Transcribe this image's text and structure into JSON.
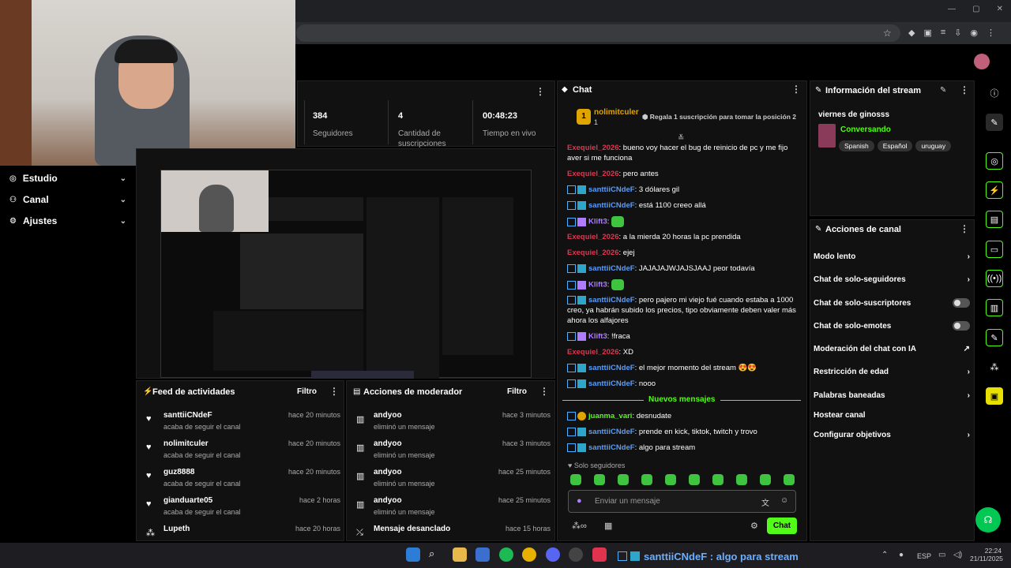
{
  "browser": {
    "window_controls": [
      "—",
      "▢",
      "✕"
    ]
  },
  "sidebar": {
    "items": [
      {
        "label": "Estudio",
        "icon": "camera-icon"
      },
      {
        "label": "Canal",
        "icon": "users-icon"
      },
      {
        "label": "Ajustes",
        "icon": "gear-icon"
      }
    ]
  },
  "stats": [
    {
      "value": "384",
      "label": "Seguidores"
    },
    {
      "value": "4",
      "label": "Cantidad de suscripciones"
    },
    {
      "value": "00:48:23",
      "label": "Tiempo en vivo"
    }
  ],
  "chat": {
    "title": "Chat",
    "pinned": {
      "rank": "1",
      "user": "nolimitculer",
      "count": "1",
      "cta": "Regala 1 suscripción para tomar la posición 2"
    },
    "messages": [
      {
        "user": "Exequiel_2026",
        "color": "red",
        "text": "bueno voy hacer el bug de reinicio de pc y me fijo aver si me funciona"
      },
      {
        "user": "Exequiel_2026",
        "color": "red",
        "text": "pero antes"
      },
      {
        "user": "santtiiCNdeF",
        "color": "blue",
        "text": "3 dólares gil"
      },
      {
        "user": "santtiiCNdeF",
        "color": "blue",
        "text": "está 1100 creeo allá"
      },
      {
        "user": "Klift3",
        "color": "purple",
        "text": ""
      },
      {
        "user": "Exequiel_2026",
        "color": "red",
        "text": "a la mierda 20 horas la pc prendida"
      },
      {
        "user": "Exequiel_2026",
        "color": "red",
        "text": "ejej"
      },
      {
        "user": "santtiiCNdeF",
        "color": "blue",
        "text": "JAJAJAJWJAJSJAAJ peor todavía"
      },
      {
        "user": "Klift3",
        "color": "purple",
        "text": ""
      },
      {
        "user": "santtiiCNdeF",
        "color": "blue",
        "text": "pero pajero mi viejo fué cuando estaba a 1000 creo, ya habrán subido los precios, tipo obviamente deben valer más ahora los alfajores"
      },
      {
        "user": "Klift3",
        "color": "purple",
        "text": "!fraca"
      },
      {
        "user": "Exequiel_2026",
        "color": "red",
        "text": "XD"
      },
      {
        "user": "santtiiCNdeF",
        "color": "blue",
        "text": "el mejor momento del stream 😍😍"
      },
      {
        "user": "santtiiCNdeF",
        "color": "blue",
        "text": "nooo"
      }
    ],
    "new_divider": "Nuevos mensajes",
    "new_messages": [
      {
        "user": "juanma_vari",
        "color": "green",
        "text": "desnudate"
      },
      {
        "user": "santtiiCNdeF",
        "color": "blue",
        "text": "prende en kick, tiktok, twitch y trovo"
      },
      {
        "user": "santtiiCNdeF",
        "color": "blue",
        "text": "algo para stream"
      }
    ],
    "mode_label": "Solo seguidores",
    "input_placeholder": "Enviar un mensaje",
    "send_label": "Chat"
  },
  "stream_info": {
    "title": "Información del stream",
    "stream_title": "viernes de ginosss",
    "category": "Conversando",
    "tags": [
      "Spanish",
      "Español",
      "uruguay"
    ]
  },
  "channel_actions": {
    "title": "Acciones de canal",
    "items": [
      {
        "label": "Modo lento",
        "control": "chevron"
      },
      {
        "label": "Chat de solo-seguidores",
        "control": "chevron"
      },
      {
        "label": "Chat de solo-suscriptores",
        "control": "toggle"
      },
      {
        "label": "Chat de solo-emotes",
        "control": "toggle"
      },
      {
        "label": "Moderación del chat con IA",
        "control": "external"
      },
      {
        "label": "Restricción de edad",
        "control": "chevron"
      },
      {
        "label": "Palabras baneadas",
        "control": "chevron"
      },
      {
        "label": "Hostear canal",
        "control": "none"
      },
      {
        "label": "Configurar objetivos",
        "control": "chevron"
      }
    ]
  },
  "activity_feed": {
    "title": "Feed de actividades",
    "filter": "Filtro",
    "items": [
      {
        "user": "santtiiCNdeF",
        "sub": "acaba de seguir el canal",
        "time": "hace 20 minutos"
      },
      {
        "user": "nolimitculer",
        "sub": "acaba de seguir el canal",
        "time": "hace 20 minutos"
      },
      {
        "user": "guz8888",
        "sub": "acaba de seguir el canal",
        "time": "hace 20 minutos"
      },
      {
        "user": "gianduarte05",
        "sub": "acaba de seguir el canal",
        "time": "hace 2 horas"
      },
      {
        "user": "Lupeth",
        "sub": "",
        "time": "hace 20 horas"
      }
    ]
  },
  "mod_actions": {
    "title": "Acciones de moderador",
    "filter": "Filtro",
    "items": [
      {
        "user": "andyoo",
        "sub": "eliminó un mensaje",
        "time": "hace 3 minutos"
      },
      {
        "user": "andyoo",
        "sub": "eliminó un mensaje",
        "time": "hace 3 minutos"
      },
      {
        "user": "andyoo",
        "sub": "eliminó un mensaje",
        "time": "hace 25 minutos"
      },
      {
        "user": "andyoo",
        "sub": "eliminó un mensaje",
        "time": "hace 25 minutos"
      },
      {
        "user": "Mensaje desanclado",
        "sub": "",
        "time": "hace 15 horas"
      }
    ]
  },
  "taskbar": {
    "notification": "santtiiCNdeF : algo para stream",
    "lang": "ESP",
    "time": "22:24",
    "date": "21/11/2025"
  },
  "colors": {
    "accent": "#53fc18",
    "red_user": "#e0344e",
    "blue_user": "#5b9cf7",
    "purple_user": "#b07cff"
  }
}
